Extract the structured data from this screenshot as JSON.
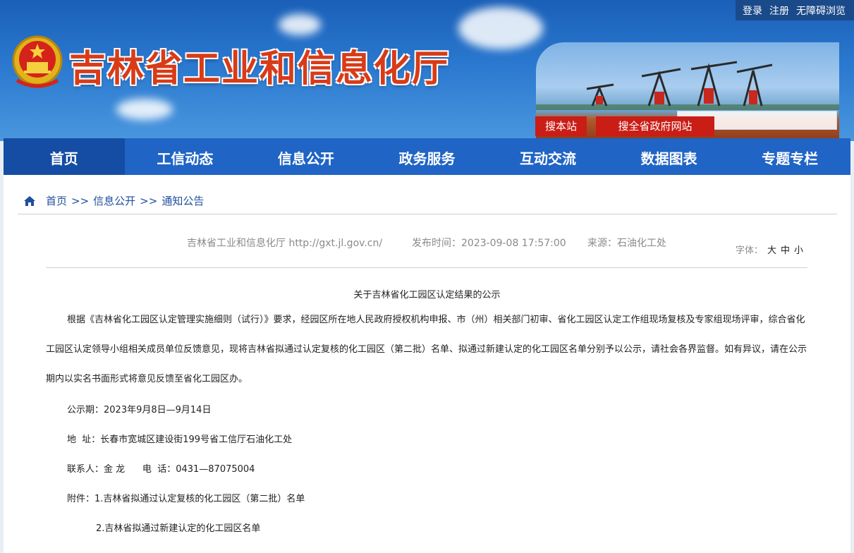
{
  "site": {
    "title": "吉林省工业和信息化厅",
    "top_links": [
      "登录",
      "注册",
      "无障碍浏览"
    ],
    "search_local": "搜本站",
    "search_all": "搜全省政府网站"
  },
  "nav": [
    "首页",
    "工信动态",
    "信息公开",
    "政务服务",
    "互动交流",
    "数据图表",
    "专题专栏"
  ],
  "breadcrumb": [
    "首页",
    "信息公开",
    "通知公告"
  ],
  "breadcrumb_sep": ">>",
  "meta": {
    "source_site": "吉林省工业和信息化厅 http://gxt.jl.gov.cn/",
    "publish_time": "发布时间：2023-09-08 17:57:00",
    "origin": "来源：石油化工处",
    "font_label": "字体：",
    "font_large": "大",
    "font_medium": "中",
    "font_small": "小"
  },
  "article": {
    "title": "关于吉林省化工园区认定结果的公示",
    "body": "根据《吉林省化工园区认定管理实施细则（试行）》要求，经园区所在地人民政府授权机构申报、市（州）相关部门初审、省化工园区认定工作组现场复核及专家组现场评审，综合省化工园区认定领导小组相关成员单位反馈意见，现将吉林省拟通过认定复核的化工园区（第二批）名单、拟通过新建认定的化工园区名单分别予以公示，请社会各界监督。如有异议，请在公示期内以实名书面形式将意见反馈至省化工园区办。",
    "period": "公示期：2023年9月8日—9月14日",
    "address": "地  址：长春市宽城区建设街199号省工信厅石油化工处",
    "contact": "联系人：金 龙      电  话：0431—87075004",
    "attachment1": "附件：1.吉林省拟通过认定复核的化工园区（第二批）名单",
    "attachment2": "2.吉林省拟通过新建认定的化工园区名单"
  }
}
